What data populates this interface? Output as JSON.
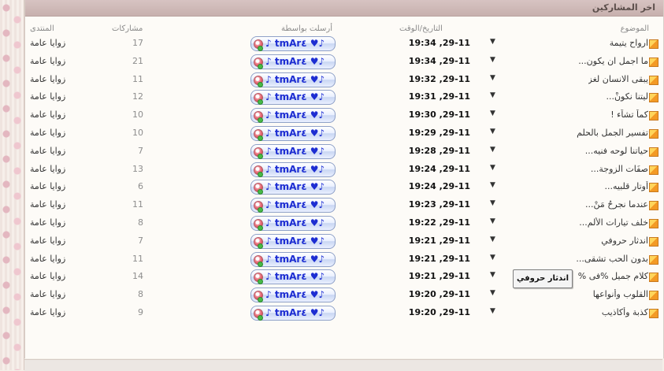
{
  "header": {
    "title": "اخر المشاركين"
  },
  "columns": {
    "forum": "المنتدى",
    "posts": "مشاركات",
    "posted_by": "أرسلت بواسطة",
    "datetime": "التاريخ/الوقت",
    "topic": "الموضوع"
  },
  "rows": [
    {
      "topic": "ارواح يتيمة",
      "datetime": "19:34 ,29-11",
      "user": "♪ tmAr٤ ♥♪",
      "posts": "17",
      "forum": "زوايا عامة"
    },
    {
      "topic": "ما اجمل ان يكون...",
      "datetime": "19:34 ,29-11",
      "user": "♪ tmAr٤ ♥♪",
      "posts": "21",
      "forum": "زوايا عامة"
    },
    {
      "topic": "يبقى الانسان لغز",
      "datetime": "19:32 ,29-11",
      "user": "♪ tmAr٤ ♥♪",
      "posts": "11",
      "forum": "زوايا عامة"
    },
    {
      "topic": "ليتنا نكونْ...",
      "datetime": "19:31 ,29-11",
      "user": "♪ tmAr٤ ♥♪",
      "posts": "12",
      "forum": "زوايا عامة"
    },
    {
      "topic": "كماَ تشاَء !",
      "datetime": "19:30 ,29-11",
      "user": "♪ tmAr٤ ♥♪",
      "posts": "10",
      "forum": "زوايا عامة"
    },
    {
      "topic": "تفسير الجمل بالحلم",
      "datetime": "19:29 ,29-11",
      "user": "♪ tmAr٤ ♥♪",
      "posts": "10",
      "forum": "زوايا عامة"
    },
    {
      "topic": "حياتنا لوحه فنيه...",
      "datetime": "19:28 ,29-11",
      "user": "♪ tmAr٤ ♥♪",
      "posts": "7",
      "forum": "زوايا عامة"
    },
    {
      "topic": "صفَات الزوجة...",
      "datetime": "19:24 ,29-11",
      "user": "♪ tmAr٤ ♥♪",
      "posts": "13",
      "forum": "زوايا عامة"
    },
    {
      "topic": "أوتار قلبيه...",
      "datetime": "19:24 ,29-11",
      "user": "♪ tmAr٤ ♥♪",
      "posts": "6",
      "forum": "زوايا عامة"
    },
    {
      "topic": "عندما نجرحُ مَنْ...",
      "datetime": "19:23 ,29-11",
      "user": "♪ tmAr٤ ♥♪",
      "posts": "11",
      "forum": "زوايا عامة"
    },
    {
      "topic": "خلف تيارات الألم...",
      "datetime": "19:22 ,29-11",
      "user": "♪ tmAr٤ ♥♪",
      "posts": "8",
      "forum": "زوايا عامة"
    },
    {
      "topic": "اندثار حروفي",
      "datetime": "19:21 ,29-11",
      "user": "♪ tmAr٤ ♥♪",
      "posts": "7",
      "forum": "زوايا عامة"
    },
    {
      "topic": "بدون الحب تشقى...",
      "datetime": "19:21 ,29-11",
      "user": "♪ tmAr٤ ♥♪",
      "posts": "11",
      "forum": "زوايا عامة"
    },
    {
      "topic": "كلام جميل %فى %",
      "datetime": "19:21 ,29-11",
      "user": "♪ tmAr٤ ♥♪",
      "posts": "14",
      "forum": "زوايا عامة"
    },
    {
      "topic": "القلوب وأنواعها",
      "datetime": "19:20 ,29-11",
      "user": "♪ tmAr٤ ♥♪",
      "posts": "8",
      "forum": "زوايا عامة"
    },
    {
      "topic": "كذبة وأكاذيب",
      "datetime": "19:20 ,29-11",
      "user": "♪ tmAr٤ ♥♪",
      "posts": "9",
      "forum": "زوايا عامة"
    }
  ],
  "tooltip": {
    "text": "اندثار حروفي"
  },
  "icons": {
    "row_arrow": "dropdown-arrow-icon",
    "user_avatar": "user-status-icon",
    "topic": "folder-icon"
  },
  "colors": {
    "header": "#c9b1af",
    "username": "#1d2dd2",
    "background": "#fdfbf7"
  }
}
